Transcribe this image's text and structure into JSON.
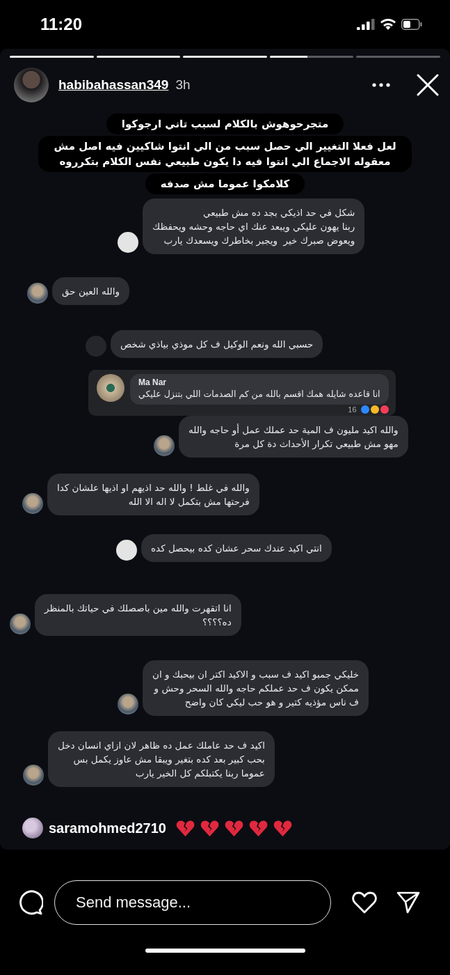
{
  "status_bar": {
    "time": "11:20"
  },
  "progress": [
    {
      "seen": true
    },
    {
      "seen": true
    },
    {
      "seen": true
    },
    {
      "seen": false,
      "level": 0.45
    },
    {
      "seen": false
    }
  ],
  "header": {
    "username": "habibahassan349",
    "time": "3h"
  },
  "caption": [
    "متجرحوهوش بالكلام لسبب تاني  ارجوكوا",
    "لعل فعلا  التغيير الي حصل  سبب من الي انتوا شاكيين فيه اصل مش\nمعقوله الاجماع الي انتوا فيه دا يكون طبيعي نفس الكلام بتكرروه",
    "كلامكوا عموما مش صدفه"
  ],
  "comments": [
    {
      "kind": "plain",
      "text": "شكل في حد اذيكي بجد ده مش طبيعي\nربنا يهون عليكي ويبعد عنك اي حاجه وحشه ويحفظك\nويعوض صبرك خير  ويجبر بخاطرك ويسعدك يارب"
    },
    {
      "kind": "photo",
      "text": "والله العين حق"
    },
    {
      "kind": "blank",
      "text": "حسبي الله ونعم الوكيل ف كل موذي بياذي شخص"
    },
    {
      "kind": "card",
      "name": "Ma Nar",
      "text": "انا قاعده شايله همك اقسم بالله من كم الصدمات اللي بتنزل عليكي",
      "count": "16"
    },
    {
      "kind": "photo",
      "text": "والله اكيد مليون ف المية حد عملك عمل أو حاجه والله\nمهو مش طبيعي تكرار الأحداث دة كل مرة"
    },
    {
      "kind": "photo",
      "text": "والله في غلط ! والله حد اذيهم او اذيها علشان كدا\nفرحتها مش بتكمل لا اله الا الله"
    },
    {
      "kind": "plain",
      "text": "انتي اكيد عندك سحر عشان كده بيحصل كده"
    },
    {
      "kind": "photo",
      "text": "انا اتقهرت والله مين باصصلك في حياتك بالمنظر\nده؟؟؟؟"
    },
    {
      "kind": "photo",
      "text": "خليكي جمبو اكيد ف سبب و الاكيد اكتر ان بيحبك و ان\nممكن يكون ف حد عملكم حاجه والله السحر وحش و\nف ناس مؤذيه كتير و هو حب ليكي كان واضح"
    },
    {
      "kind": "photo",
      "text": "اكيد ف حد عاملك عمل ده ظاهر لان ازاي انسان دخل\nبحب كبير بعد كده بتغير ويبقا مش عاوز يكمل بس\nعموما ربنا يكتبلكم كل الخير يارب"
    }
  ],
  "mention": {
    "username": "saramohmed2710"
  },
  "reply": {
    "placeholder": "Send message..."
  }
}
